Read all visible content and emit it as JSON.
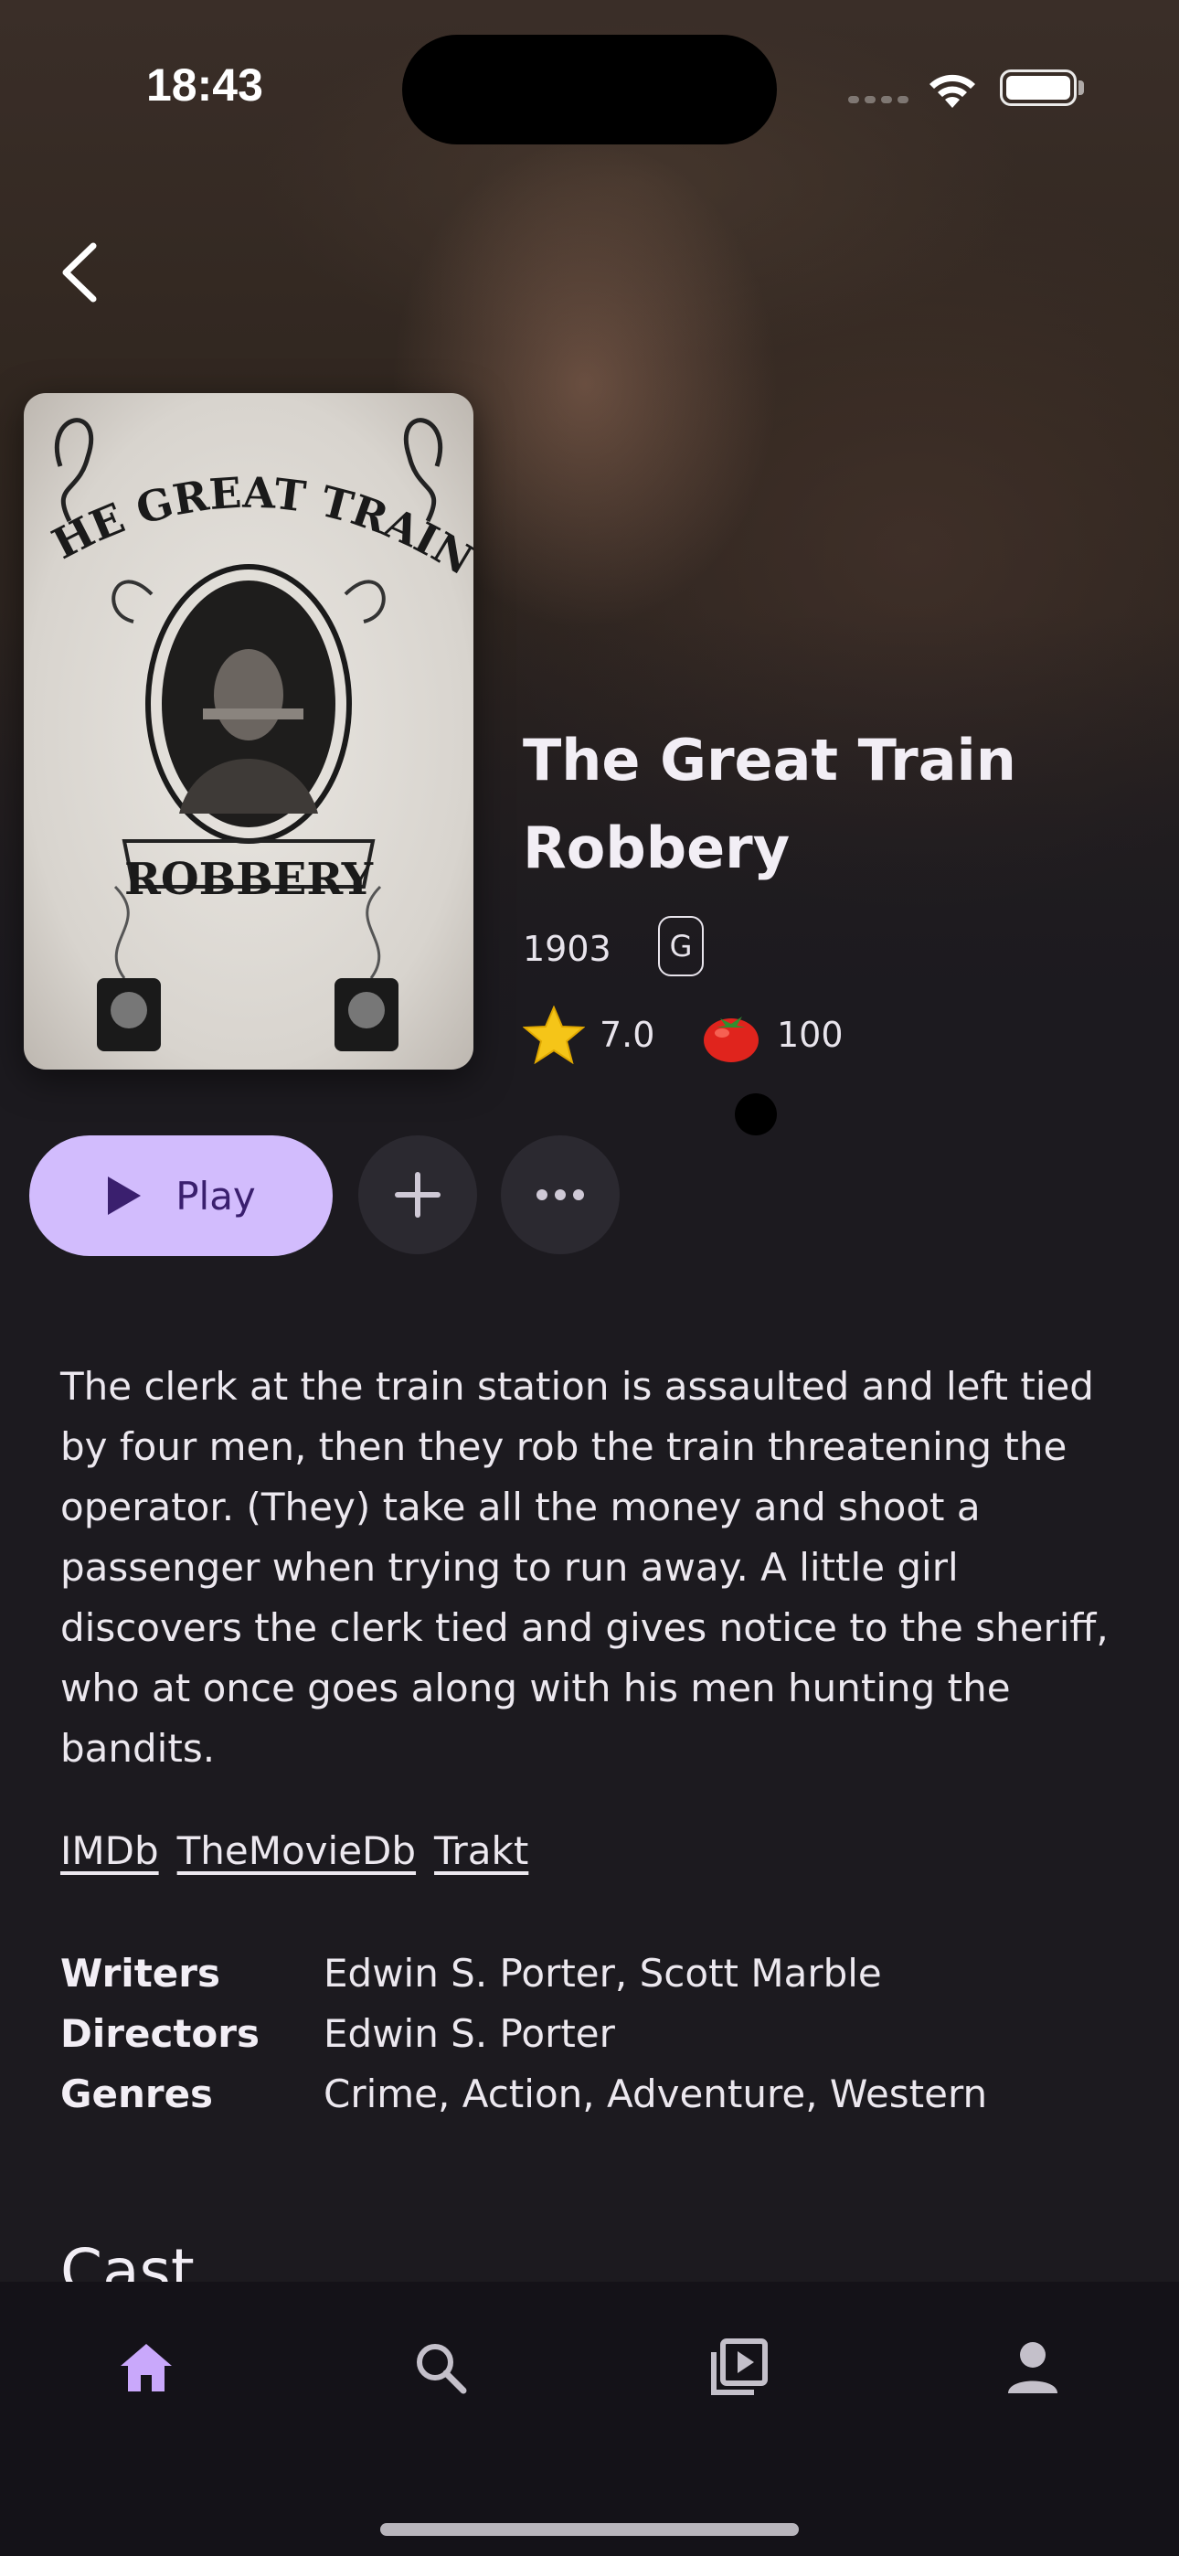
{
  "status_bar": {
    "time": "18:43"
  },
  "movie": {
    "title": "The Great Train Robbery",
    "year": "1903",
    "rating": "G",
    "community_score": "7.0",
    "critic_score": "100",
    "overview": "The clerk at the train station is assaulted and left tied by four men, then they rob the train threatening the operator. (They) take all the money and shoot a passenger when trying to run away. A little girl discovers the clerk tied and gives notice to the sheriff, who at once goes along with his men hunting the bandits."
  },
  "poster": {
    "title_top": "THE GREAT TRAIN",
    "title_bottom": "ROBBERY"
  },
  "actions": {
    "play_label": "Play"
  },
  "links": [
    "IMDb",
    "TheMovieDb",
    "Trakt"
  ],
  "credits": [
    {
      "key": "Writers",
      "value": "Edwin S. Porter, Scott Marble"
    },
    {
      "key": "Directors",
      "value": "Edwin S. Porter"
    },
    {
      "key": "Genres",
      "value": "Crime, Action, Adventure, Western"
    }
  ],
  "sections": {
    "cast_heading": "Cast"
  },
  "nav": {
    "items": [
      {
        "icon": "home-icon",
        "active": true
      },
      {
        "icon": "search-icon",
        "active": false
      },
      {
        "icon": "library-icon",
        "active": false
      },
      {
        "icon": "profile-icon",
        "active": false
      }
    ]
  },
  "colors": {
    "accent": "#d2bcfd",
    "accent_icon": "#c9a8fb",
    "background": "#1c1a1f",
    "nav_background": "#141218"
  }
}
